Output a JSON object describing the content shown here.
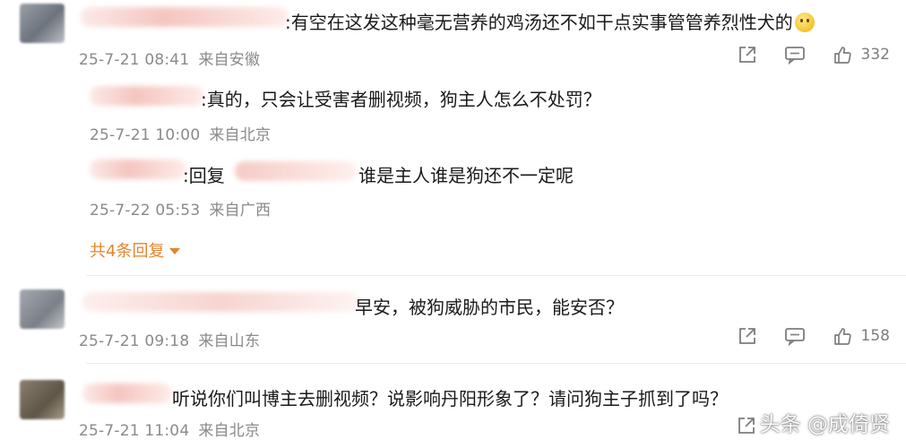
{
  "comments": [
    {
      "text": "有空在这发这种毫无营养的鸡汤还不如干点实事管管养烈性犬的",
      "emoji": "smile-emoji",
      "date": "25-7-21 08:41",
      "location": "来自安徽",
      "likes": "332",
      "replies": [
        {
          "text": "真的，只会让受害者删视频，狗主人怎么不处罚？",
          "date": "25-7-21 10:00",
          "location": "来自北京"
        },
        {
          "text": "回复",
          "text2": "谁是主人谁是狗还不一定呢",
          "date": "25-7-22 05:53",
          "location": "来自广西"
        }
      ],
      "more_replies": "共4条回复"
    },
    {
      "text": "早安，被狗威胁的市民，能安否？",
      "date": "25-7-21 09:18",
      "location": "来自山东",
      "likes": "158"
    },
    {
      "text": "听说你们叫博主去删视频？说影响丹阳形象了？请问狗主子抓到了吗？",
      "date": "25-7-21 11:04",
      "location": "来自北京"
    }
  ],
  "watermark": "头条 @成倚贤",
  "colors": {
    "accent": "#e5842e",
    "meta": "#8a8a8a"
  }
}
